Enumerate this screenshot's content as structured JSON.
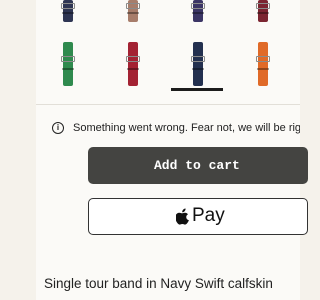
{
  "notice": {
    "text": "Something went wrong. Fear not, we will be rig"
  },
  "cart": {
    "add_label": "Add to cart"
  },
  "payment": {
    "apple_pay_label": "Pay"
  },
  "product": {
    "name": "Single tour band in Navy Swift calfskin"
  },
  "swatches": {
    "top_row": [
      {
        "name": "navy",
        "color": "#2e3553",
        "buckle_color": "#8a8a8a"
      },
      {
        "name": "tan",
        "color": "#a77d6b",
        "buckle_color": "#8a8a8a"
      },
      {
        "name": "navy-purple",
        "color": "#3b3565",
        "buckle_color": "#8a8a8a"
      },
      {
        "name": "burgundy",
        "color": "#7b2531",
        "buckle_color": "#8a8a8a"
      }
    ],
    "bottom_row": [
      {
        "name": "green",
        "color": "#2f8a4e",
        "buckle_color": "#8a8a8a"
      },
      {
        "name": "red",
        "color": "#a32233",
        "buckle_color": "#8a8a8a"
      },
      {
        "name": "navy",
        "color": "#23304f",
        "buckle_color": "#8a8a8a",
        "selected": true
      },
      {
        "name": "orange",
        "color": "#e06a28",
        "buckle_color": "#8a8a8a"
      }
    ]
  },
  "colors": {
    "page_bg": "#f5f2eb",
    "button_dark": "#444441"
  }
}
